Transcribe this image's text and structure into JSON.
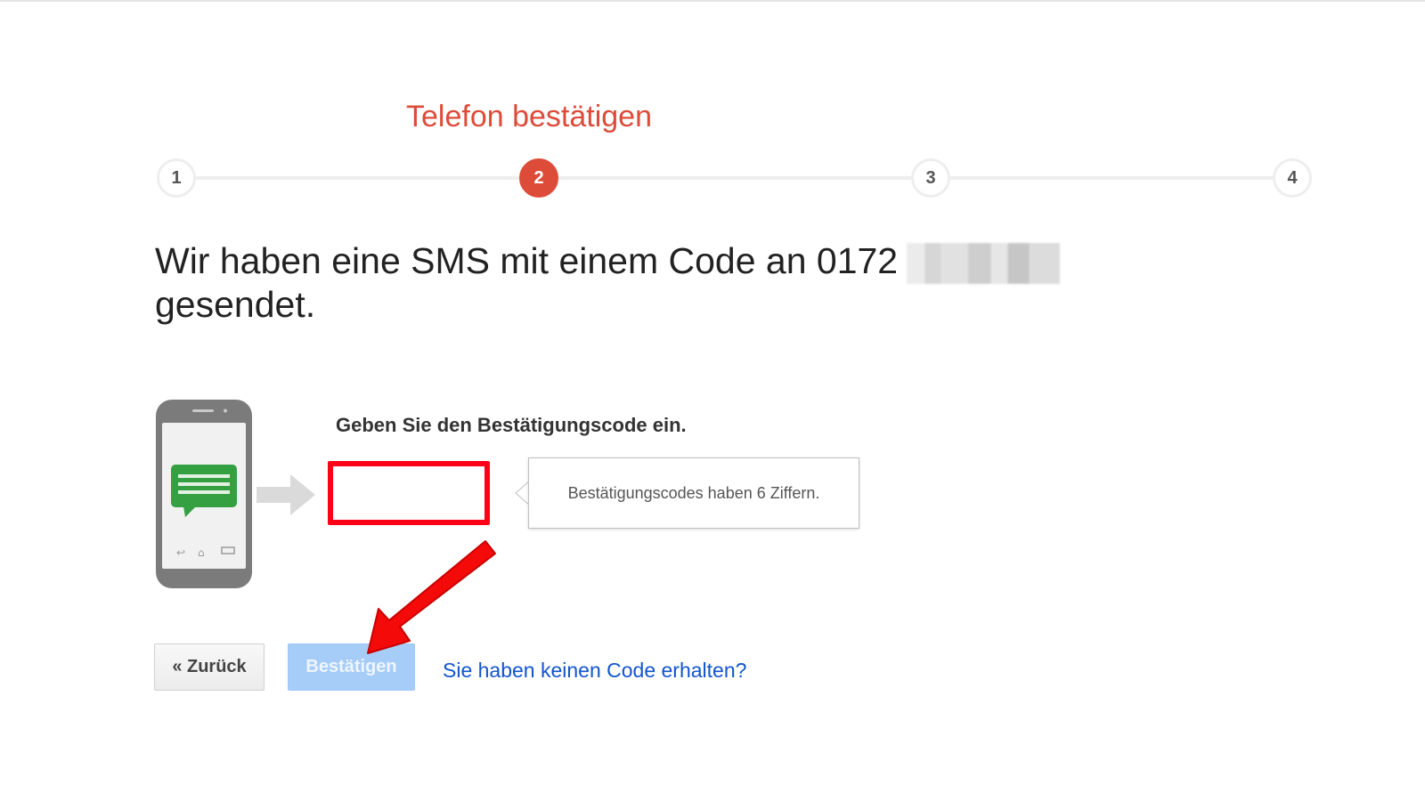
{
  "stepper": {
    "title": "Telefon bestätigen",
    "steps": [
      "1",
      "2",
      "3",
      "4"
    ],
    "active_step": 2,
    "accent_color": "#dd4b39"
  },
  "headline": {
    "text_part1": "Wir haben eine SMS mit einem Code an 0172",
    "text_part2": "gesendet."
  },
  "code_entry": {
    "label": "Geben Sie den Bestätigungscode ein.",
    "value": "",
    "placeholder": "",
    "hint": "Bestätigungscodes haben 6 Ziffern."
  },
  "actions": {
    "back_label": "« Zurück",
    "confirm_label": "Bestätigen",
    "no_code_link": "Sie haben keinen Code erhalten?"
  },
  "icons": {
    "phone": "phone-sms-icon",
    "arrow": "arrow-right-icon",
    "annotation": "red-arrow-annotation-icon"
  }
}
